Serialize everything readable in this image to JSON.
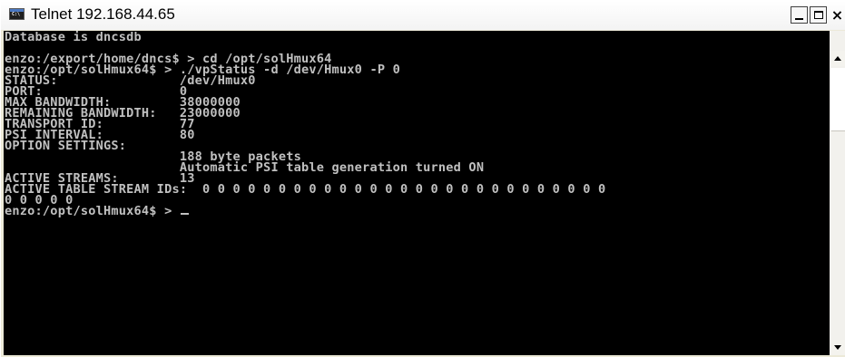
{
  "window": {
    "title": "Telnet 192.168.44.65",
    "icon": "console-icon",
    "controls": {
      "minimize": "minimize-icon",
      "maximize": "maximize-icon",
      "close": "×"
    }
  },
  "console": {
    "lines": [
      "Database is dncsdb",
      "",
      "enzo:/export/home/dncs$ > cd /opt/solHmux64",
      "enzo:/opt/solHmux64$ > ./vpStatus -d /dev/Hmux0 -P 0",
      "STATUS:                /dev/Hmux0",
      "PORT:                  0",
      "MAX BANDWIDTH:         38000000",
      "REMAINING BANDWIDTH:   23000000",
      "TRANSPORT ID:          77",
      "PSI INTERVAL:          80",
      "OPTION SETTINGS:",
      "                       188 byte packets",
      "                       Automatic PSI table generation turned ON",
      "ACTIVE STREAMS:        13",
      "ACTIVE TABLE STREAM IDs:  0 0 0 0 0 0 0 0 0 0 0 0 0 0 0 0 0 0 0 0 0 0 0 0 0 0 0",
      "0 0 0 0 0",
      "enzo:/opt/solHmux64$ > "
    ],
    "colors": {
      "background": "#000000",
      "foreground": "#c0c0c0"
    }
  }
}
